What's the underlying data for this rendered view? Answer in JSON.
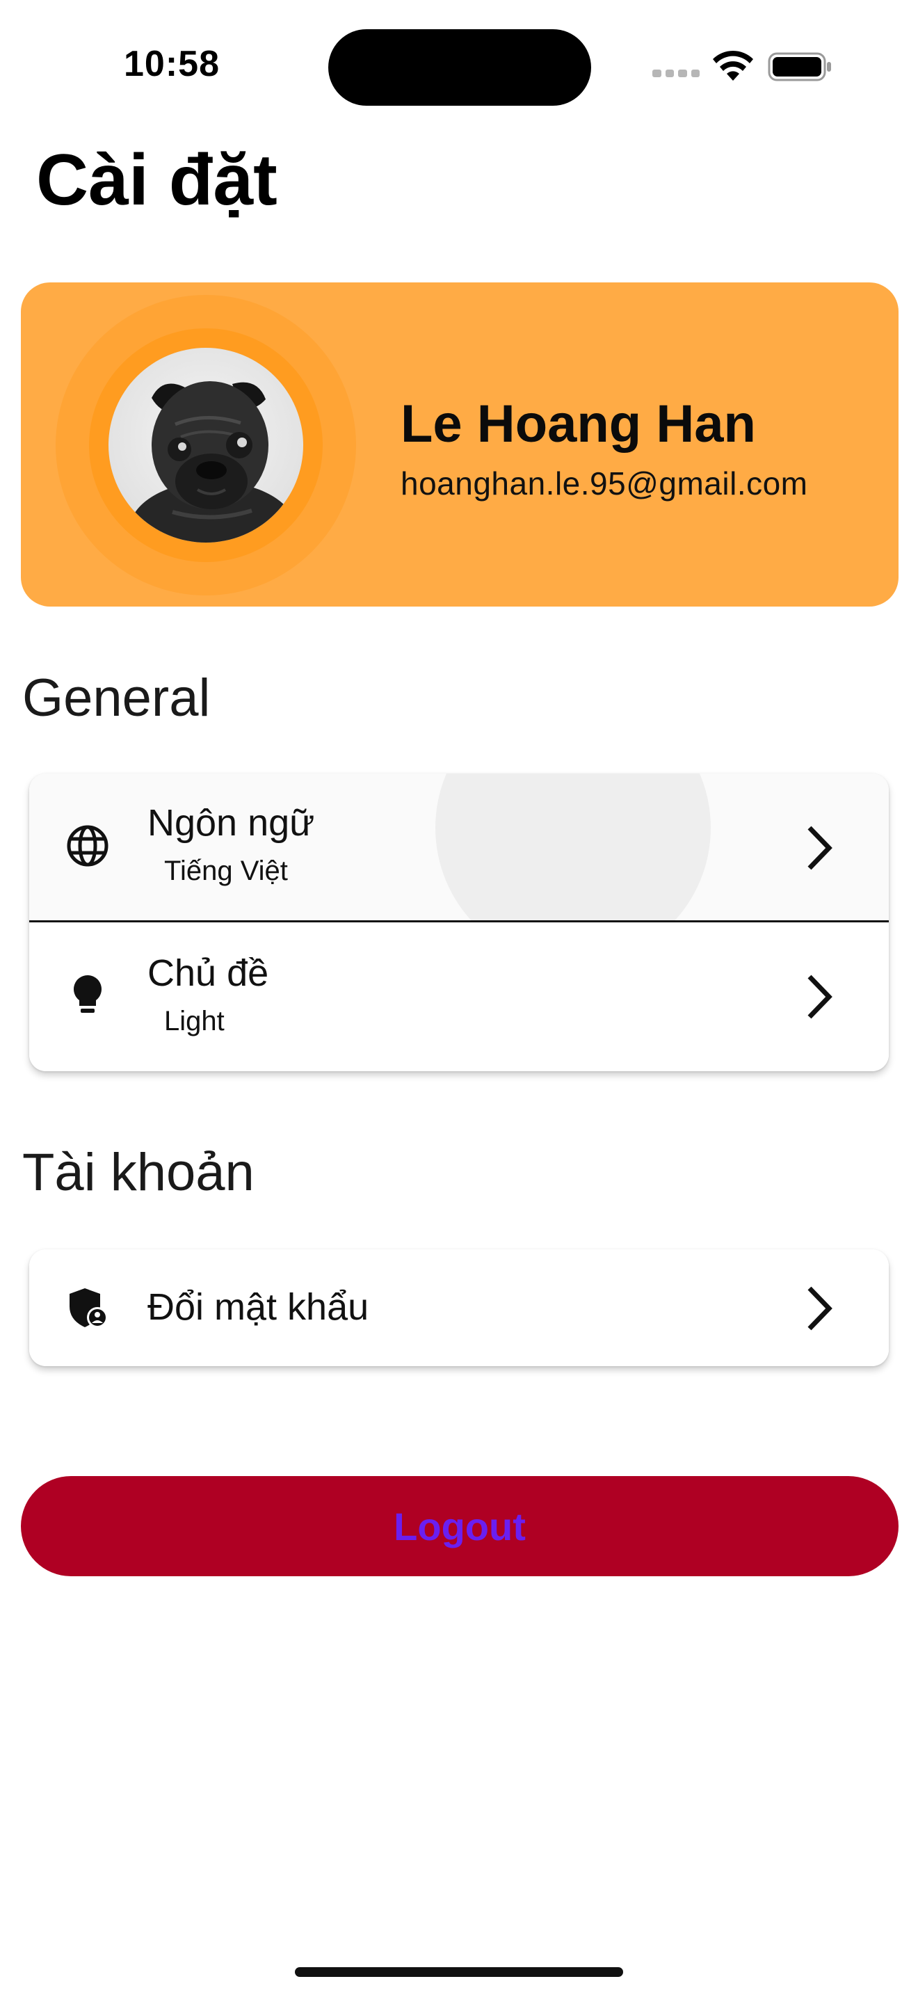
{
  "status_bar": {
    "time": "10:58"
  },
  "page": {
    "title": "Cài đặt"
  },
  "profile": {
    "name": "Le Hoang Han",
    "email": "hoanghan.le.95@gmail.com",
    "avatar_icon": "pug-dog-photo",
    "accent_color": "#ffab45"
  },
  "sections": {
    "general": {
      "header": "General",
      "items": [
        {
          "title": "Ngôn ngữ",
          "subtitle": "Tiếng Việt",
          "icon": "globe-icon"
        },
        {
          "title": "Chủ đề",
          "subtitle": "Light",
          "icon": "lightbulb-icon"
        }
      ]
    },
    "account": {
      "header": "Tài khoản",
      "items": [
        {
          "title": "Đổi mật khẩu",
          "icon": "shield-user-icon"
        }
      ]
    }
  },
  "logout": {
    "label": "Logout",
    "background_color": "#af0023",
    "text_color": "#6a1ff0"
  }
}
